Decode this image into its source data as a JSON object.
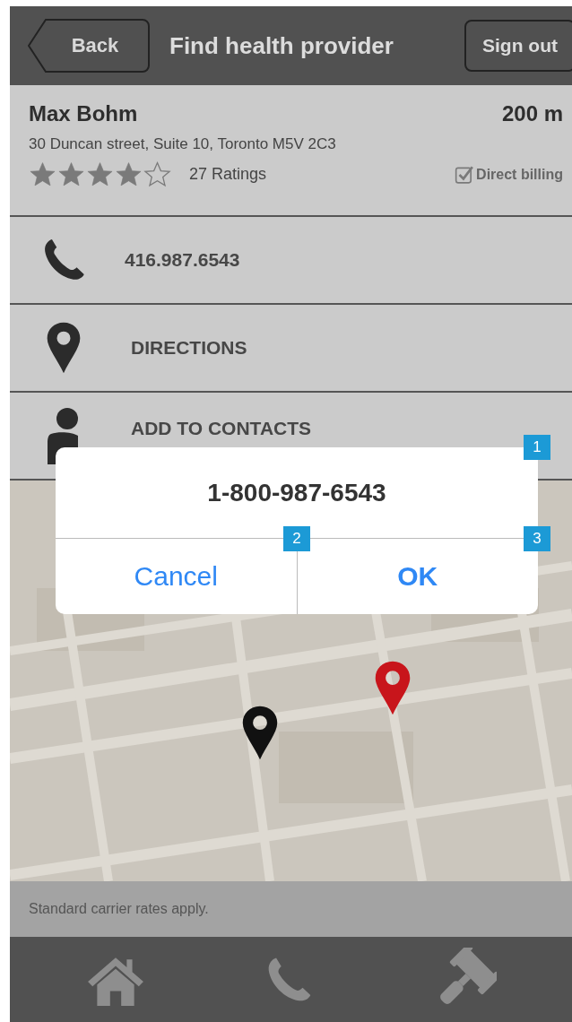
{
  "header": {
    "back": "Back",
    "title": "Find health provider",
    "sign_out": "Sign out"
  },
  "provider": {
    "name": "Max Bohm",
    "distance": "200 m",
    "address": "30 Duncan street, Suite 10, Toronto M5V 2C3",
    "stars": 4,
    "ratings": "27 Ratings",
    "direct_billing": {
      "label": "Direct billing",
      "checked": true
    }
  },
  "actions": [
    {
      "kind": "phone",
      "label": "416.987.6543"
    },
    {
      "kind": "directions",
      "label": "DIRECTIONS"
    },
    {
      "kind": "contact",
      "label": "ADD TO CONTACTS"
    }
  ],
  "map": {
    "kind": "picture",
    "pins": [
      {
        "color": "#111111"
      },
      {
        "color": "#c8151b"
      }
    ]
  },
  "note": "Standard carrier rates apply.",
  "tab_bar": [
    {
      "kind": "home"
    },
    {
      "kind": "phone"
    },
    {
      "kind": "gavel"
    }
  ],
  "dialog": {
    "number": "1-800-987-6543",
    "buttons": [
      {
        "kind": "cancel",
        "label": "Cancel"
      },
      {
        "kind": "ok",
        "label": "OK"
      }
    ]
  },
  "annotations": [
    "1",
    "2",
    "3"
  ]
}
